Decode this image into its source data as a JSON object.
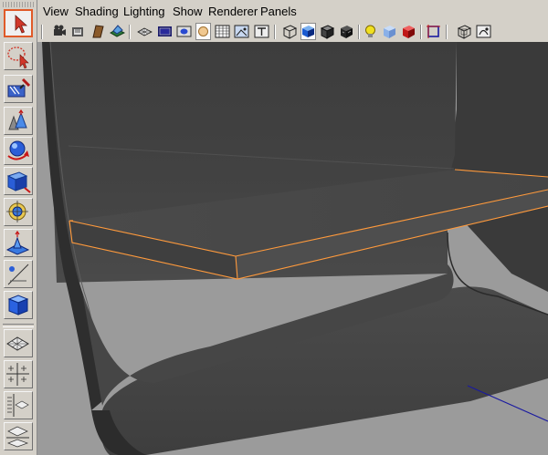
{
  "menubar": {
    "items": [
      "View",
      "Shading",
      "Lighting",
      "Show",
      "Renderer",
      "Panels"
    ]
  },
  "toolbox": {
    "tools": [
      {
        "name": "select-tool",
        "icon": "select-arrow-icon",
        "active": true
      },
      {
        "name": "lasso-tool",
        "icon": "lasso-icon",
        "active": false
      },
      {
        "name": "paint-select-tool",
        "icon": "paint-brush-icon",
        "active": false
      },
      {
        "name": "move-tool",
        "icon": "move-icon",
        "active": false
      },
      {
        "name": "rotate-tool",
        "icon": "rotate-icon",
        "active": false
      },
      {
        "name": "scale-tool",
        "icon": "scale-icon",
        "active": false
      },
      {
        "name": "universal-manipulator-tool",
        "icon": "universal-manipulator-icon",
        "active": false
      },
      {
        "name": "soft-modification-tool",
        "icon": "soft-mod-icon",
        "active": false
      },
      {
        "name": "show-manipulator-tool",
        "icon": "show-manipulator-icon",
        "active": false
      },
      {
        "name": "last-used-tool",
        "icon": "cube-icon",
        "active": false
      }
    ],
    "layouts": [
      "single-pane-layout-icon",
      "four-pane-layout-icon",
      "outliner-persp-layout-icon",
      "persp-graph-layout-icon"
    ]
  },
  "iconbar": {
    "icons": [
      "select-camera-icon",
      "camera-attributes-icon",
      "bookmark-icon",
      "image-plane-icon",
      "grid-icon",
      "film-gate-icon",
      "resolution-gate-icon",
      "gate-mask-icon",
      "field-chart-icon",
      "safe-action-icon",
      "safe-title-icon",
      "wireframe-icon",
      "smooth-shade-icon",
      "wireframe-on-shaded-icon",
      "textured-icon",
      "use-all-lights-icon",
      "xray-icon",
      "xray-joints-icon",
      "isolate-select-icon",
      "high-quality-icon",
      "ao-icon"
    ],
    "active": "smooth-shade-icon"
  },
  "colors": {
    "selection_highlight": "#ff9a3c",
    "viewport_background": "#9b9b9b",
    "mesh_dark": "#3c3c3c"
  }
}
